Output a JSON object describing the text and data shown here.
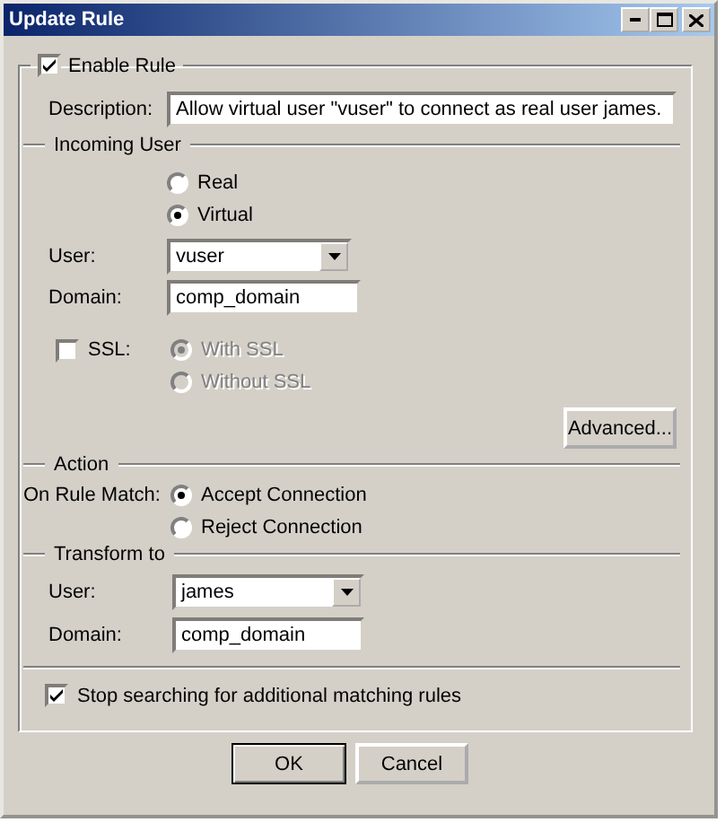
{
  "window": {
    "title": "Update Rule"
  },
  "enable_rule": {
    "label": "Enable Rule",
    "checked": true
  },
  "description": {
    "label": "Description:",
    "value": "Allow virtual user \"vuser\" to connect as real user james."
  },
  "incoming_user": {
    "title": "Incoming User",
    "user_type": [
      {
        "label": "Real",
        "selected": false
      },
      {
        "label": "Virtual",
        "selected": true
      }
    ],
    "user": {
      "label": "User:",
      "value": "vuser"
    },
    "domain": {
      "label": "Domain:",
      "value": "comp_domain"
    },
    "ssl": {
      "label": "SSL:",
      "checked": false
    },
    "ssl_mode": [
      {
        "label": "With SSL",
        "selected": true,
        "disabled": true
      },
      {
        "label": "Without SSL",
        "selected": false,
        "disabled": true
      }
    ],
    "advanced_button": "Advanced..."
  },
  "action": {
    "title": "Action",
    "label": "On Rule Match:",
    "options": [
      {
        "label": "Accept Connection",
        "selected": true
      },
      {
        "label": "Reject Connection",
        "selected": false
      }
    ]
  },
  "transform_to": {
    "title": "Transform to",
    "user": {
      "label": "User:",
      "value": "james"
    },
    "domain": {
      "label": "Domain:",
      "value": "comp_domain"
    }
  },
  "stop_searching": {
    "label": "Stop searching for additional matching rules",
    "checked": true
  },
  "buttons": [
    "OK",
    "Cancel"
  ]
}
